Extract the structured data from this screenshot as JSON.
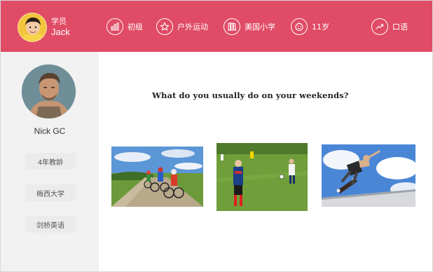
{
  "header": {
    "student_role": "学员",
    "student_name": "Jack",
    "background_color": "#e04b65",
    "tags": [
      {
        "icon": "bar-chart-icon",
        "label": "初级"
      },
      {
        "icon": "star-icon",
        "label": "户外运动"
      },
      {
        "icon": "books-icon",
        "label": "美国小学"
      },
      {
        "icon": "smiley-face-icon",
        "label": "11岁"
      },
      {
        "icon": "trend-up-icon",
        "label": "口语"
      }
    ]
  },
  "sidebar": {
    "teacher_name": "Nick GC",
    "chips": [
      "4年教龄",
      "梅西大学",
      "剑桥英语"
    ]
  },
  "main": {
    "question": "What do you usually do on your weekends?",
    "options": [
      {
        "icon": "cycling-photo"
      },
      {
        "icon": "soccer-photo"
      },
      {
        "icon": "skateboard-photo"
      }
    ]
  }
}
